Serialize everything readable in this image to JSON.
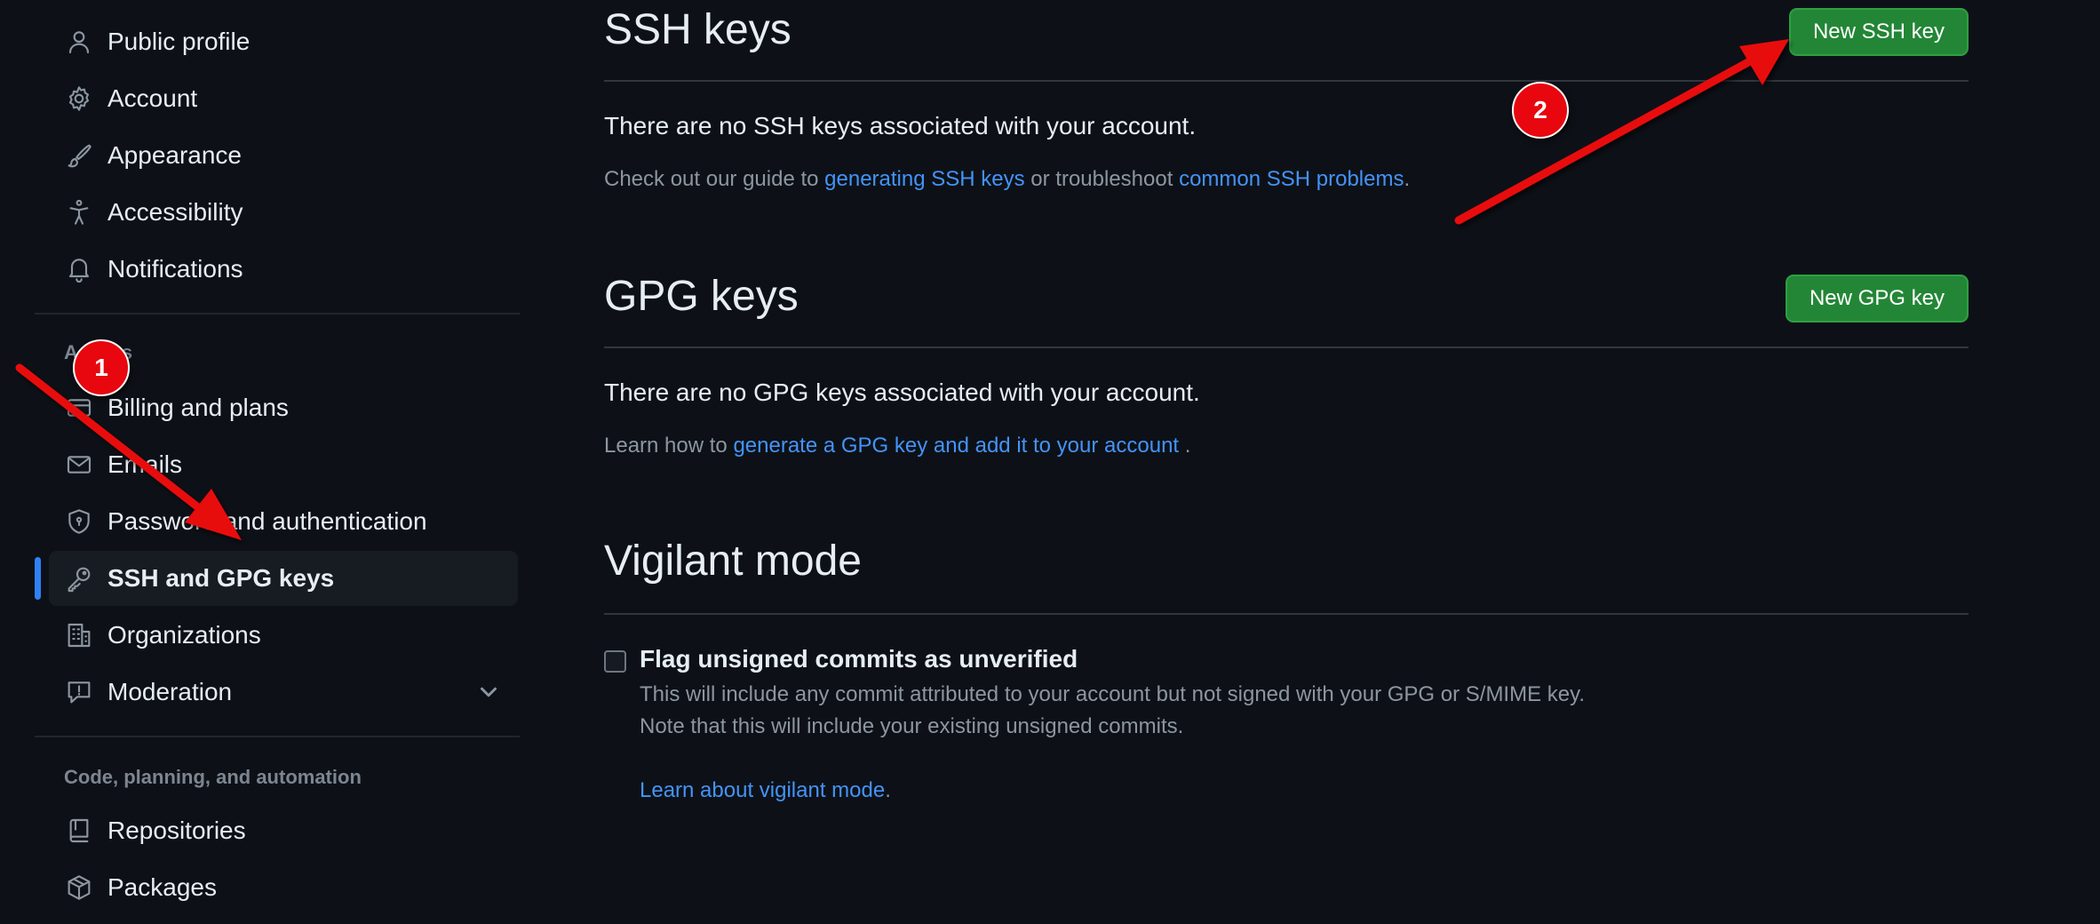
{
  "sidebar": {
    "items_top": [
      {
        "label": "Public profile",
        "icon": "person-icon"
      },
      {
        "label": "Account",
        "icon": "gear-icon"
      },
      {
        "label": "Appearance",
        "icon": "paintbrush-icon"
      },
      {
        "label": "Accessibility",
        "icon": "accessibility-icon"
      },
      {
        "label": "Notifications",
        "icon": "bell-icon"
      }
    ],
    "access_heading": "Access",
    "items_access": [
      {
        "label": "Billing and plans",
        "icon": "credit-card-icon"
      },
      {
        "label": "Emails",
        "icon": "mail-icon"
      },
      {
        "label": "Password and authentication",
        "icon": "shield-lock-icon"
      },
      {
        "label": "SSH and GPG keys",
        "icon": "key-icon",
        "active": true
      },
      {
        "label": "Organizations",
        "icon": "organization-icon"
      },
      {
        "label": "Moderation",
        "icon": "report-icon",
        "expandable": true
      }
    ],
    "code_heading": "Code, planning, and automation",
    "items_code": [
      {
        "label": "Repositories",
        "icon": "repo-icon"
      },
      {
        "label": "Packages",
        "icon": "package-icon"
      }
    ]
  },
  "ssh": {
    "title": "SSH keys",
    "button": "New SSH key",
    "empty": "There are no SSH keys associated with your account.",
    "help_prefix": "Check out our guide to ",
    "help_link1": "generating SSH keys",
    "help_middle": " or troubleshoot ",
    "help_link2": "common SSH problems",
    "help_suffix": "."
  },
  "gpg": {
    "title": "GPG keys",
    "button": "New GPG key",
    "empty": "There are no GPG keys associated with your account.",
    "help_prefix": "Learn how to ",
    "help_link": "generate a GPG key and add it to your account",
    "help_suffix": " ."
  },
  "vigilant": {
    "title": "Vigilant mode",
    "checkbox_label": "Flag unsigned commits as unverified",
    "checked": false,
    "desc1": "This will include any commit attributed to your account but not signed with your GPG or S/MIME key.",
    "desc2": "Note that this will include your existing unsigned commits.",
    "link": "Learn about vigilant mode",
    "link_suffix": "."
  },
  "annotations": {
    "badge1": "1",
    "badge2": "2",
    "arrow_color": "#e8070f"
  },
  "colors": {
    "background": "#0d1117",
    "accent_green": "#238636",
    "link_blue": "#4493f8",
    "active_bar": "#2f81f7"
  }
}
